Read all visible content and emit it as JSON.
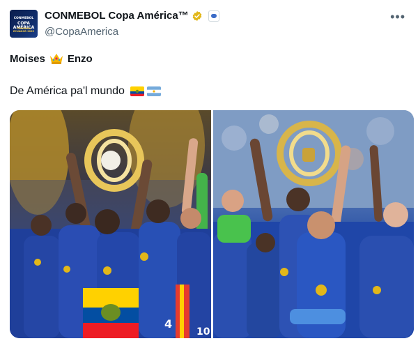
{
  "author": {
    "name": "CONMEBOL Copa América™",
    "handle": "@CopaAmerica",
    "avatar_text": {
      "line1": "CONMEBOL",
      "line2": "COPA AMÉRICA",
      "line3": "FEMENINA ECUADOR 2025"
    }
  },
  "tweet": {
    "line1_left": "Moises",
    "line1_right": "Enzo",
    "line2": "De América pa'l mundo"
  },
  "icons": {
    "verified": "verified-badge-icon",
    "affiliate": "affiliate-icon",
    "more": "more-options-icon",
    "crown": "crown-emoji-icon",
    "flag_1": "ecuador-flag-icon",
    "flag_2": "argentina-flag-icon"
  },
  "media": {
    "photo_left": {
      "jersey_numbers": [
        "4",
        "10"
      ]
    }
  },
  "colors": {
    "text": "#0f1419",
    "muted": "#536471",
    "gold": "#e2b719",
    "chelsea_blue": "#1f46a8"
  }
}
